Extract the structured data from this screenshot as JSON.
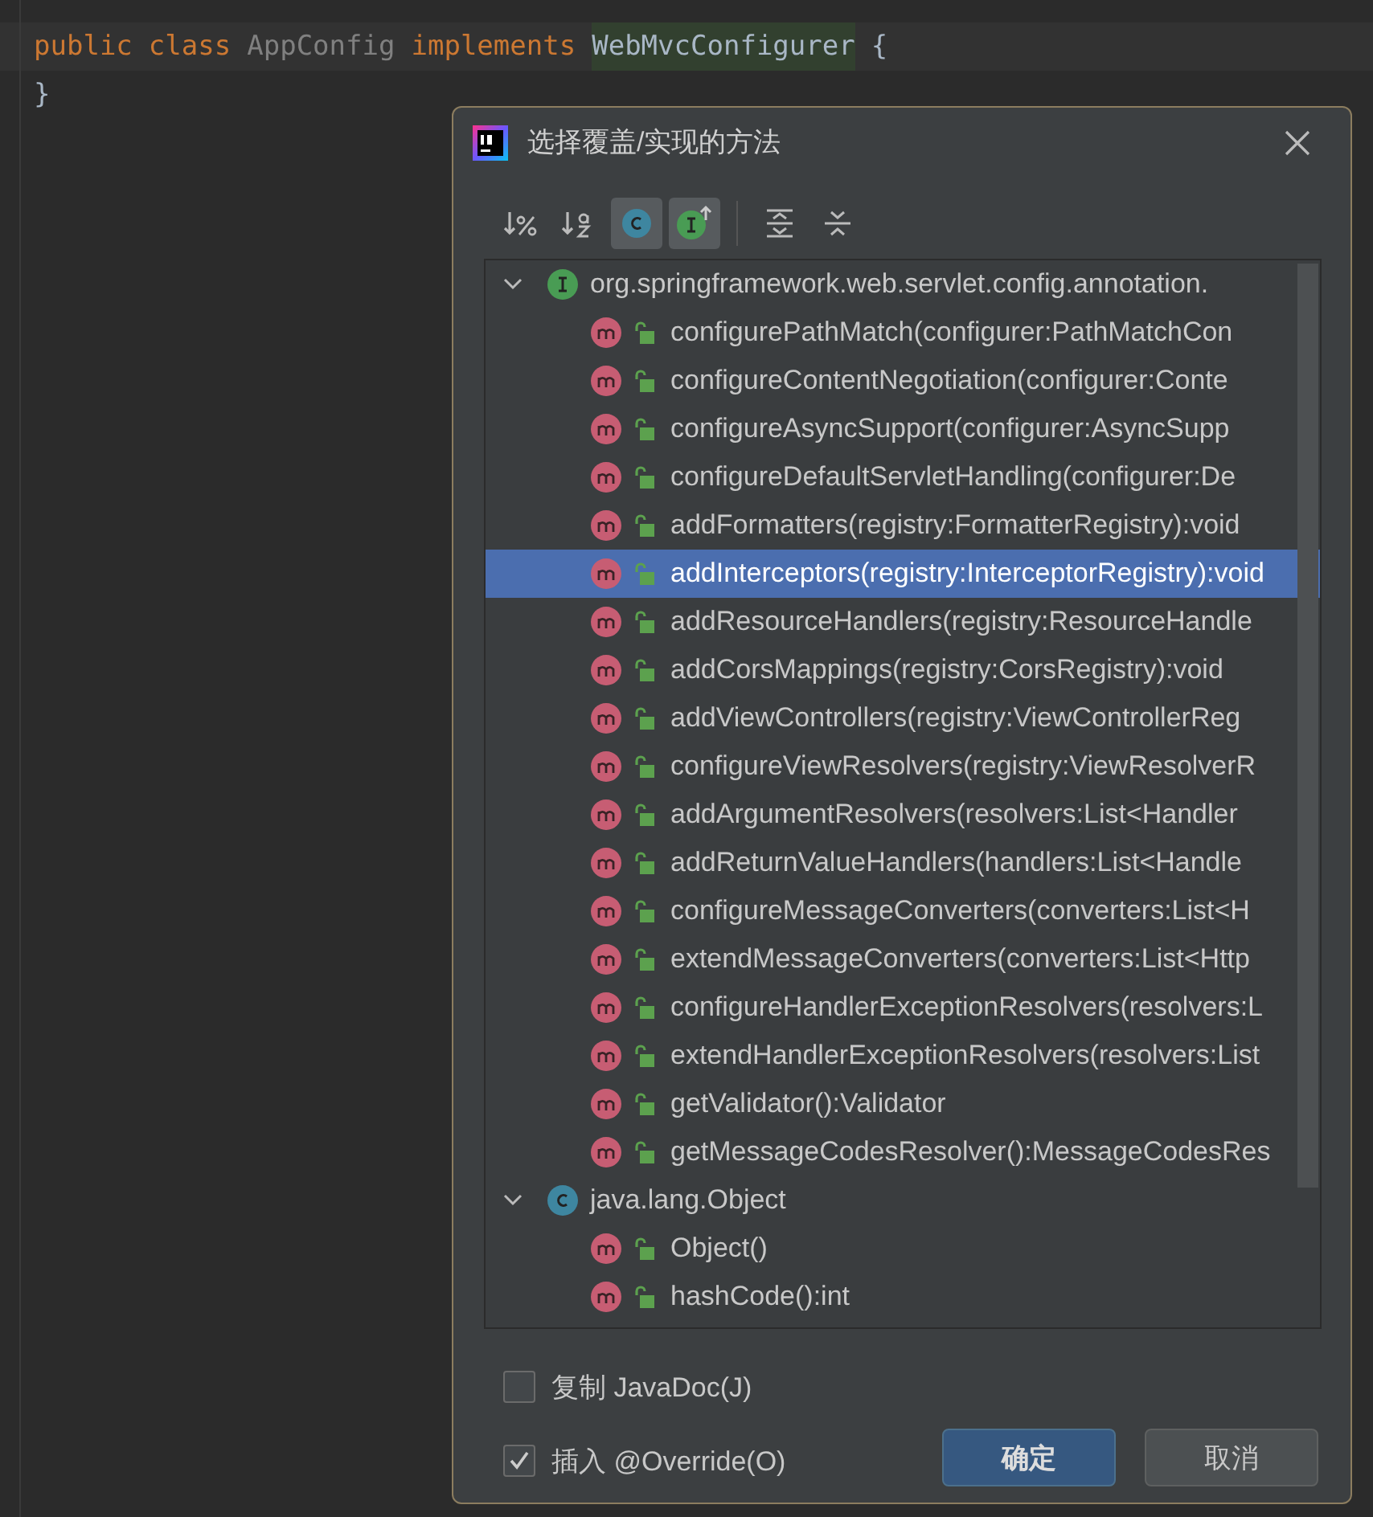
{
  "editor": {
    "lines": [
      {
        "tokens": [
          {
            "text": "public",
            "kind": "keyword"
          },
          {
            "text": "class",
            "kind": "keyword"
          },
          {
            "text": "AppConfig",
            "kind": "unused"
          },
          {
            "text": "implements",
            "kind": "keyword"
          },
          {
            "text": "WebMvcConfigurer",
            "kind": "highlighted"
          },
          {
            "text": "{",
            "kind": "plain"
          }
        ]
      },
      {
        "tokens": [
          {
            "text": "}",
            "kind": "plain"
          }
        ]
      }
    ]
  },
  "dialog": {
    "title": "选择覆盖/实现的方法",
    "toolbar": [
      {
        "kind": "sort-visibility",
        "selected": false
      },
      {
        "kind": "sort-alpha",
        "selected": false
      },
      {
        "kind": "show-classes",
        "selected": true
      },
      {
        "kind": "show-interfaces",
        "selected": true
      },
      {
        "kind": "divider"
      },
      {
        "kind": "expand-all",
        "selected": false
      },
      {
        "kind": "collapse-all",
        "selected": false
      }
    ],
    "tree": [
      {
        "label": "org.springframework.web.servlet.config.annotation.",
        "kind": "interface",
        "expanded": true,
        "children": [
          {
            "label": "configurePathMatch(configurer:PathMatchCon",
            "selected": false
          },
          {
            "label": "configureContentNegotiation(configurer:Conte",
            "selected": false
          },
          {
            "label": "configureAsyncSupport(configurer:AsyncSupp",
            "selected": false
          },
          {
            "label": "configureDefaultServletHandling(configurer:De",
            "selected": false
          },
          {
            "label": "addFormatters(registry:FormatterRegistry):void",
            "selected": false
          },
          {
            "label": "addInterceptors(registry:InterceptorRegistry):void",
            "selected": true
          },
          {
            "label": "addResourceHandlers(registry:ResourceHandle",
            "selected": false
          },
          {
            "label": "addCorsMappings(registry:CorsRegistry):void",
            "selected": false
          },
          {
            "label": "addViewControllers(registry:ViewControllerReg",
            "selected": false
          },
          {
            "label": "configureViewResolvers(registry:ViewResolverR",
            "selected": false
          },
          {
            "label": "addArgumentResolvers(resolvers:List<Handler",
            "selected": false
          },
          {
            "label": "addReturnValueHandlers(handlers:List<Handle",
            "selected": false
          },
          {
            "label": "configureMessageConverters(converters:List<H",
            "selected": false
          },
          {
            "label": "extendMessageConverters(converters:List<Http",
            "selected": false
          },
          {
            "label": "configureHandlerExceptionResolvers(resolvers:L",
            "selected": false
          },
          {
            "label": "extendHandlerExceptionResolvers(resolvers:List",
            "selected": false
          },
          {
            "label": "getValidator():Validator",
            "selected": false
          },
          {
            "label": "getMessageCodesResolver():MessageCodesRes",
            "selected": false
          }
        ]
      },
      {
        "label": "java.lang.Object",
        "kind": "class",
        "expanded": true,
        "children": [
          {
            "label": "Object()",
            "selected": false
          },
          {
            "label": "hashCode():int",
            "selected": false
          }
        ]
      }
    ],
    "options": [
      {
        "label": "复制 JavaDoc(J)",
        "checked": false
      },
      {
        "label": "插入 @Override(O)",
        "checked": true
      }
    ],
    "buttons": [
      {
        "label": "确定",
        "kind": "default"
      },
      {
        "label": "取消",
        "kind": "normal"
      }
    ]
  }
}
